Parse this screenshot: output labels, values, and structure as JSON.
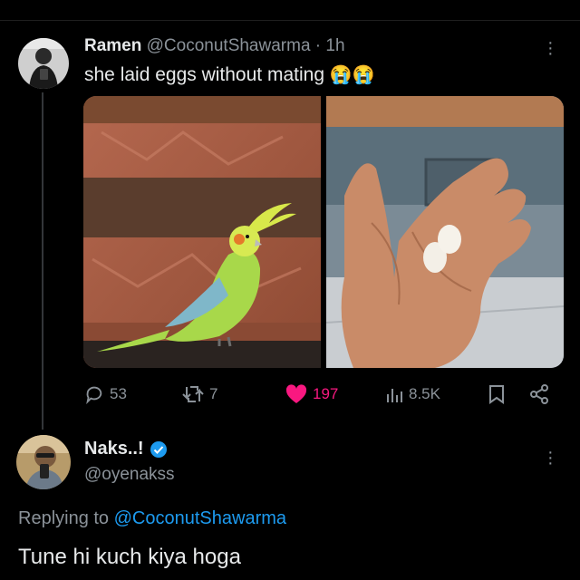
{
  "tweet": {
    "author_name": "Ramen",
    "handle": "@CoconutShawarma",
    "separator": "·",
    "time": "1h",
    "text": "she laid eggs without mating",
    "emoji": "😭😭",
    "stats": {
      "replies": "53",
      "reposts": "7",
      "likes": "197",
      "views": "8.5K"
    }
  },
  "reply": {
    "author_name": "Naks..!",
    "handle": "@oyenakss",
    "replying_prefix": "Replying to",
    "replying_handle": "@CoconutShawarma",
    "text": "Tune hi kuch kiya hoga"
  },
  "colors": {
    "background": "#000000",
    "text": "#e7e9ea",
    "muted": "#8b9299",
    "link": "#1d9bf0",
    "like": "#f91880",
    "verified": "#1d9bf0"
  },
  "icons": [
    "reply-icon",
    "repost-icon",
    "heart-icon",
    "views-icon",
    "bookmark-icon",
    "share-icon",
    "more-icon",
    "verified-icon"
  ]
}
